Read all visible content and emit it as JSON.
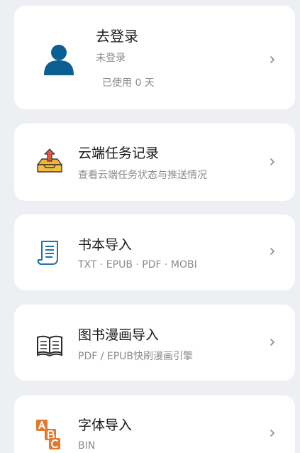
{
  "profile": {
    "name": "去登录",
    "login_status": "未登录",
    "usage": "已使用 0 天",
    "avatar_color": "#0b5f91"
  },
  "menu": [
    {
      "title": "云端任务记录",
      "subtitle": "查看云端任务状态与推送情况",
      "icon": "cloud-inbox-icon"
    },
    {
      "title": "书本导入",
      "subtitle": "TXT · EPUB · PDF · MOBI",
      "icon": "document-icon"
    },
    {
      "title": "图书漫画导入",
      "subtitle": "PDF / EPUB快刷漫画引擎",
      "icon": "open-book-icon"
    },
    {
      "title": "字体导入",
      "subtitle": "BIN",
      "icon": "abc-blocks-icon"
    }
  ],
  "colors": {
    "background": "#eeeff2",
    "card": "#ffffff",
    "accent_orange": "#e07a2e",
    "accent_blue": "#1c73ad"
  }
}
